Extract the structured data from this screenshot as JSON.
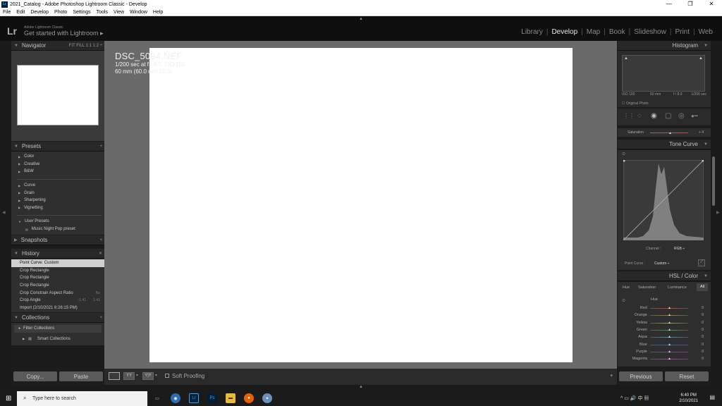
{
  "window": {
    "title": "2021_Catalog - Adobe Photoshop Lightroom Classic - Develop",
    "logo": "Lr",
    "minimize": "—",
    "maximize": "❐",
    "close": "✕"
  },
  "menu": [
    "File",
    "Edit",
    "Develop",
    "Photo",
    "Settings",
    "Tools",
    "View",
    "Window",
    "Help"
  ],
  "header": {
    "logo": "Lr",
    "product": "Adobe Lightroom Classic",
    "identity": "Get started with Lightroom",
    "identity_arrow": "▸",
    "modules": [
      "Library",
      "Develop",
      "Map",
      "Book",
      "Slideshow",
      "Print",
      "Web"
    ],
    "active_module": "Develop"
  },
  "navigator": {
    "title": "Navigator",
    "zoom": "FIT  FILL  1:1  1:2 ÷"
  },
  "presets": {
    "title": "Presets",
    "groups1": [
      "Color",
      "Creative",
      "B&W"
    ],
    "groups2": [
      "Curve",
      "Grain",
      "Sharpening",
      "Vignetting"
    ],
    "user_group": "User Presets",
    "user_item": "Music Night Pop preset"
  },
  "snapshots": {
    "title": "Snapshots"
  },
  "history": {
    "title": "History",
    "items": [
      {
        "label": "Point Curve: Custom",
        "v1": "",
        "v2": ""
      },
      {
        "label": "Crop Rectangle",
        "v1": "",
        "v2": ""
      },
      {
        "label": "Crop Rectangle",
        "v1": "",
        "v2": ""
      },
      {
        "label": "Crop Rectangle",
        "v1": "",
        "v2": ""
      },
      {
        "label": "Crop Constrain Aspect Ratio",
        "v1": "",
        "v2": "No"
      },
      {
        "label": "Crop Angle",
        "v1": "-1.41",
        "v2": "1.41"
      },
      {
        "label": "Import (2/10/2021 6:26:15 PM)",
        "v1": "",
        "v2": ""
      }
    ]
  },
  "collections": {
    "title": "Collections",
    "filter": "Filter Collections",
    "smart": "Smart Collections"
  },
  "left_buttons": {
    "copy": "Copy...",
    "paste": "Paste"
  },
  "photo_info": {
    "name": "DSC_5094.NEF",
    "exposure": "1/200 sec at f / 8.0, ISO 100",
    "lens": "60 mm (60.0 mm f/2.8)"
  },
  "toolbar": {
    "soft_proofing": "Soft Proofing"
  },
  "histogram": {
    "title": "Histogram",
    "iso": "ISO 100",
    "focal": "60 mm",
    "fstop": "f / 8.0",
    "shutter": "1/200 sec",
    "original": "Original Photo"
  },
  "saturation": {
    "label": "Saturation",
    "value": "+ 4"
  },
  "tone_curve": {
    "title": "Tone Curve",
    "channel_label": "Channel :",
    "channel_value": "RGB ÷",
    "point_curve_label": "Point Curve :",
    "point_curve_value": "Custom ÷"
  },
  "hsl": {
    "title": "HSL / Color",
    "tabs": [
      "Hue",
      "Saturation",
      "Luminance",
      "All"
    ],
    "section": "Hue",
    "rows": [
      {
        "name": "Red",
        "value": "0",
        "color": "#c04040"
      },
      {
        "name": "Orange",
        "value": "0",
        "color": "#c07030"
      },
      {
        "name": "Yellow",
        "value": "0",
        "color": "#b0a030"
      },
      {
        "name": "Green",
        "value": "0",
        "color": "#40a040"
      },
      {
        "name": "Aqua",
        "value": "0",
        "color": "#30a0a0"
      },
      {
        "name": "Blue",
        "value": "0",
        "color": "#3060c0"
      },
      {
        "name": "Purple",
        "value": "0",
        "color": "#8040b0"
      },
      {
        "name": "Magenta",
        "value": "0",
        "color": "#b040a0"
      }
    ]
  },
  "right_buttons": {
    "previous": "Previous",
    "reset": "Reset"
  },
  "taskbar": {
    "search_placeholder": "Type here to search",
    "time": "6:40 PM",
    "date": "2/10/2021",
    "ps": "Ps",
    "lr": "Lr"
  }
}
